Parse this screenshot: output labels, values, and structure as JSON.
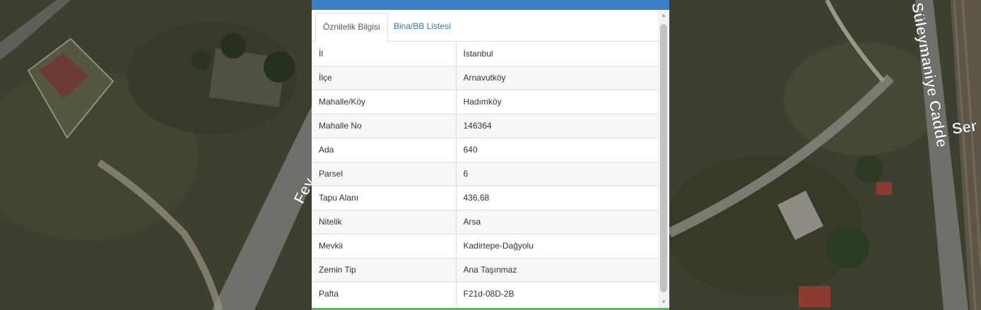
{
  "tabs": {
    "attributes": "Öznitelik Bilgisi",
    "buildings": "Bina/BB Listesi"
  },
  "attributes": [
    {
      "key": "İl",
      "value": "İstanbul"
    },
    {
      "key": "İlçe",
      "value": "Arnavutköy"
    },
    {
      "key": "Mahalle/Köy",
      "value": "Hadımköy"
    },
    {
      "key": "Mahalle No",
      "value": "146364"
    },
    {
      "key": "Ada",
      "value": "640"
    },
    {
      "key": "Parsel",
      "value": "6"
    },
    {
      "key": "Tapu Alanı",
      "value": "436,68"
    },
    {
      "key": "Nitelik",
      "value": "Arsa"
    },
    {
      "key": "Mevkii",
      "value": "Kadirtepe-Dağyolu"
    },
    {
      "key": "Zemin Tip",
      "value": "Ana Taşınmaz"
    },
    {
      "key": "Pafta",
      "value": "F21d-08D-2B"
    }
  ],
  "map": {
    "street_left": "Fey",
    "street_right": "Süleymaniye Cadde",
    "street_far_right": "Ser"
  },
  "colors": {
    "header": "#3c7fc6",
    "bottom_bar": "#5cb85c",
    "link": "#337ab7"
  }
}
